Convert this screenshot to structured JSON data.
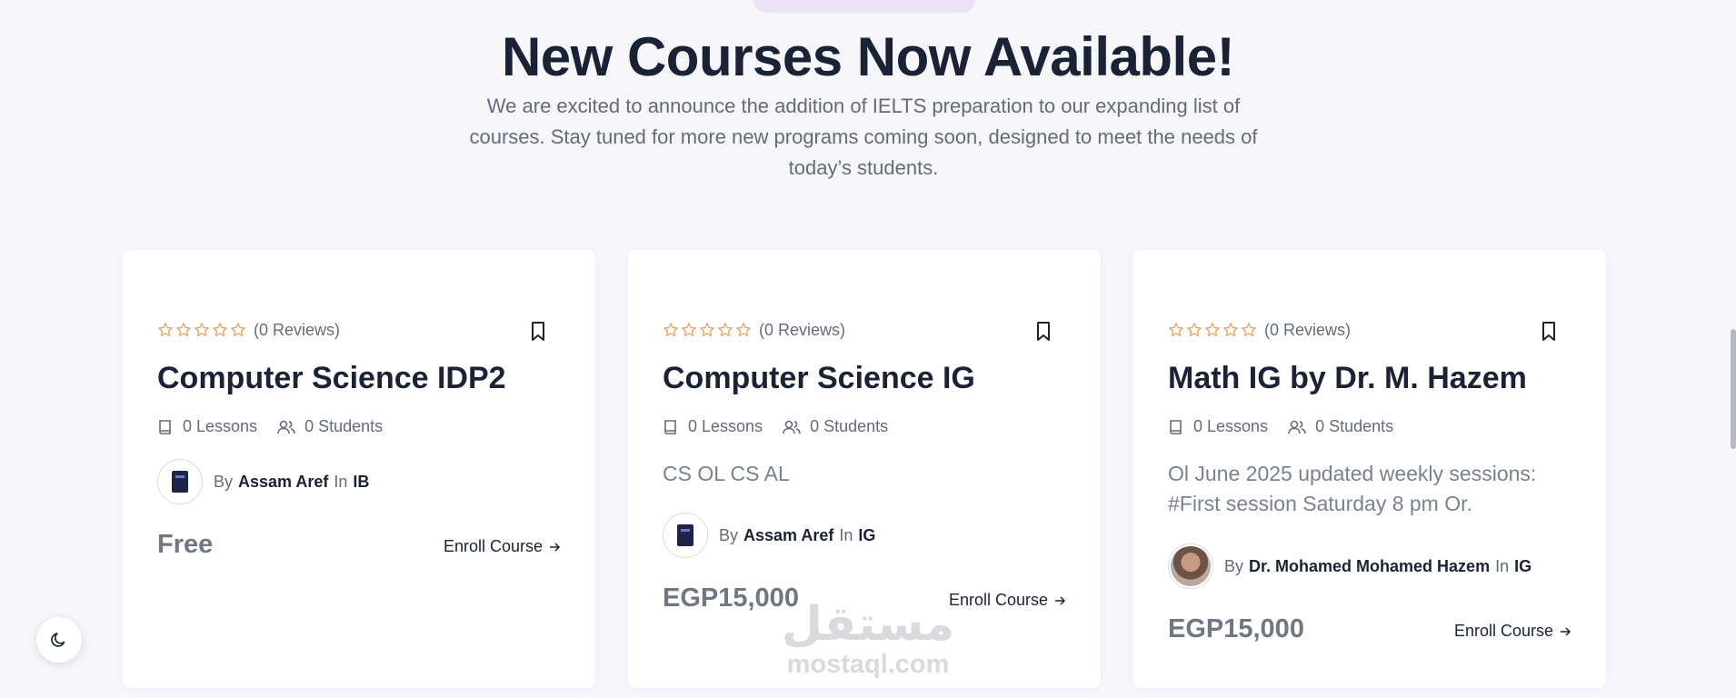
{
  "header": {
    "title": "New Courses Now Available!",
    "subtitle": "We are excited to announce the addition of IELTS preparation to our expanding list of courses. Stay tuned for more new programs coming soon, designed to meet the needs of today’s students."
  },
  "colors": {
    "star": "#e8a05a",
    "text_dark": "#1a2236",
    "text_muted": "#646b7c",
    "card_bg": "#ffffff",
    "page_bg": "#f7f6fb"
  },
  "courses": [
    {
      "reviews": "(0 Reviews)",
      "rating_stars": 0,
      "title": "Computer Science IDP2",
      "lessons": "0 Lessons",
      "students": "0 Students",
      "description": "",
      "by": "By",
      "author": "Assam Aref",
      "in": "In",
      "category": "IB",
      "price": "Free",
      "enroll": "Enroll Course"
    },
    {
      "reviews": "(0 Reviews)",
      "rating_stars": 0,
      "title": "Computer Science IG",
      "lessons": "0 Lessons",
      "students": "0 Students",
      "description": "CS OL CS AL",
      "by": "By",
      "author": "Assam Aref",
      "in": "In",
      "category": "IG",
      "price": "EGP15,000",
      "enroll": "Enroll Course"
    },
    {
      "reviews": "(0 Reviews)",
      "rating_stars": 0,
      "title": "Math IG by Dr. M. Hazem",
      "lessons": "0 Lessons",
      "students": "0 Students",
      "description": "Ol June 2025 updated weekly sessions: #First session Saturday 8 pm Or.",
      "by": "By",
      "author": "Dr. Mohamed Mohamed Hazem",
      "in": "In",
      "category": "IG",
      "price": "EGP15,000",
      "enroll": "Enroll Course"
    }
  ],
  "icons": {
    "star": "star-outline-icon",
    "bookmark": "bookmark-icon",
    "lessons": "book-icon",
    "students": "users-icon",
    "enroll_arrow": "arrow-right-icon",
    "theme_toggle": "moon-icon"
  },
  "watermark": {
    "arabic": "مستقل",
    "latin": "mostaql.com"
  }
}
